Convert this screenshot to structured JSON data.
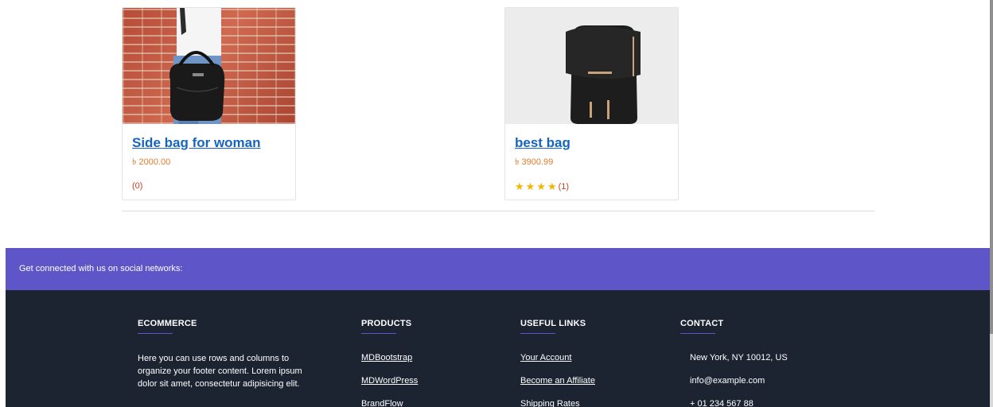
{
  "products": [
    {
      "title": "Side bag for woman",
      "price": "৳ 2000.00",
      "rating_count": "(0)",
      "stars": 0,
      "image": "woman-with-black-bag-photo"
    },
    {
      "title": "best bag",
      "price": "৳ 3900.99",
      "rating_count": "(1)",
      "stars": 4,
      "image": "black-backpack-photo"
    }
  ],
  "social": {
    "text": "Get connected with us on social networks:"
  },
  "footer": {
    "ecommerce": {
      "heading": "ECOMMERCE",
      "text": "Here you can use rows and columns to organize your footer content. Lorem ipsum dolor sit amet, consectetur adipisicing elit."
    },
    "products": {
      "heading": "PRODUCTS",
      "links": [
        "MDBootstrap",
        "MDWordPress",
        "BrandFlow"
      ]
    },
    "useful_links": {
      "heading": "USEFUL LINKS",
      "links": [
        "Your Account",
        "Become an Affiliate",
        "Shipping Rates"
      ]
    },
    "contact": {
      "heading": "CONTACT",
      "items": [
        "New York, NY 10012, US",
        "info@example.com",
        "+ 01 234 567 88"
      ]
    }
  },
  "colors": {
    "accent": "#5e56c8",
    "footer_bg": "#1c2331",
    "link": "#1565c0",
    "price": "#e07b2a",
    "star": "#f4b400"
  }
}
